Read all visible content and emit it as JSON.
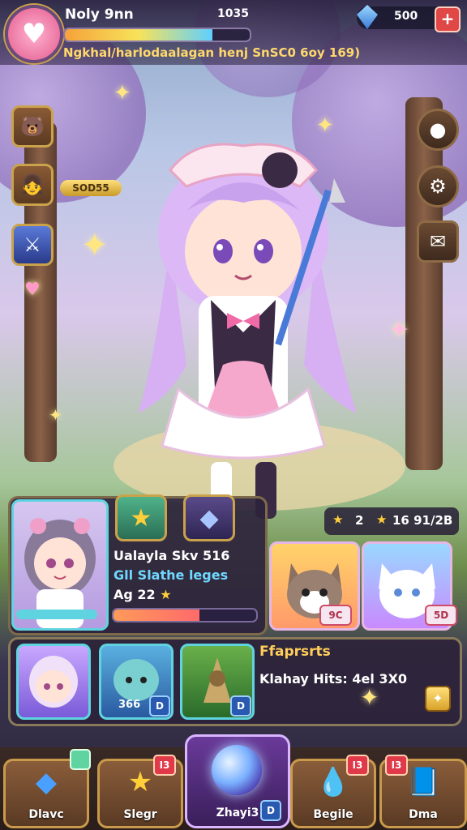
{
  "hud": {
    "player_name": "Noly 9nn",
    "score": "1035",
    "subline": "Ngkhal/harlodaalagan henj SnSC0 6oy 169)",
    "xp_progress": 0.8,
    "gems": "500",
    "plus": "+"
  },
  "side": {
    "tag_value": "SOD55"
  },
  "hero": {
    "name": "Ualayla Skv 516",
    "class": "Gll Slathe leges",
    "age": "Ag 22",
    "level_progress": 0.6,
    "stars_count": "2",
    "stars_detail": "16 91/2B"
  },
  "pets": [
    {
      "badge": "9C"
    },
    {
      "badge": "5D"
    }
  ],
  "team": {
    "cards": [
      {
        "count": "",
        "badge": ""
      },
      {
        "count": "366",
        "badge": "D"
      },
      {
        "count": "",
        "badge": "D"
      }
    ],
    "reward_title": "Ffaprsrts",
    "reward_desc": "Klahay Hits: 4el 3X0"
  },
  "nav": {
    "items": [
      {
        "label": "Dlavc",
        "icon": "diamond-icon",
        "notif": ""
      },
      {
        "label": "Slegr",
        "icon": "star-icon",
        "notif": "I3"
      },
      {
        "label": "Zhayi3",
        "icon": "orb-icon",
        "notif": "D"
      },
      {
        "label": "Begile",
        "icon": "drop-icon",
        "notif": "I3"
      },
      {
        "label": "Dma",
        "icon": "book-icon",
        "notif": ""
      }
    ],
    "extra_notif": "I3"
  },
  "colors": {
    "accent_gold": "#c9a24b",
    "hud_bg": "#2a2440",
    "notif_red": "#e03a4a"
  }
}
